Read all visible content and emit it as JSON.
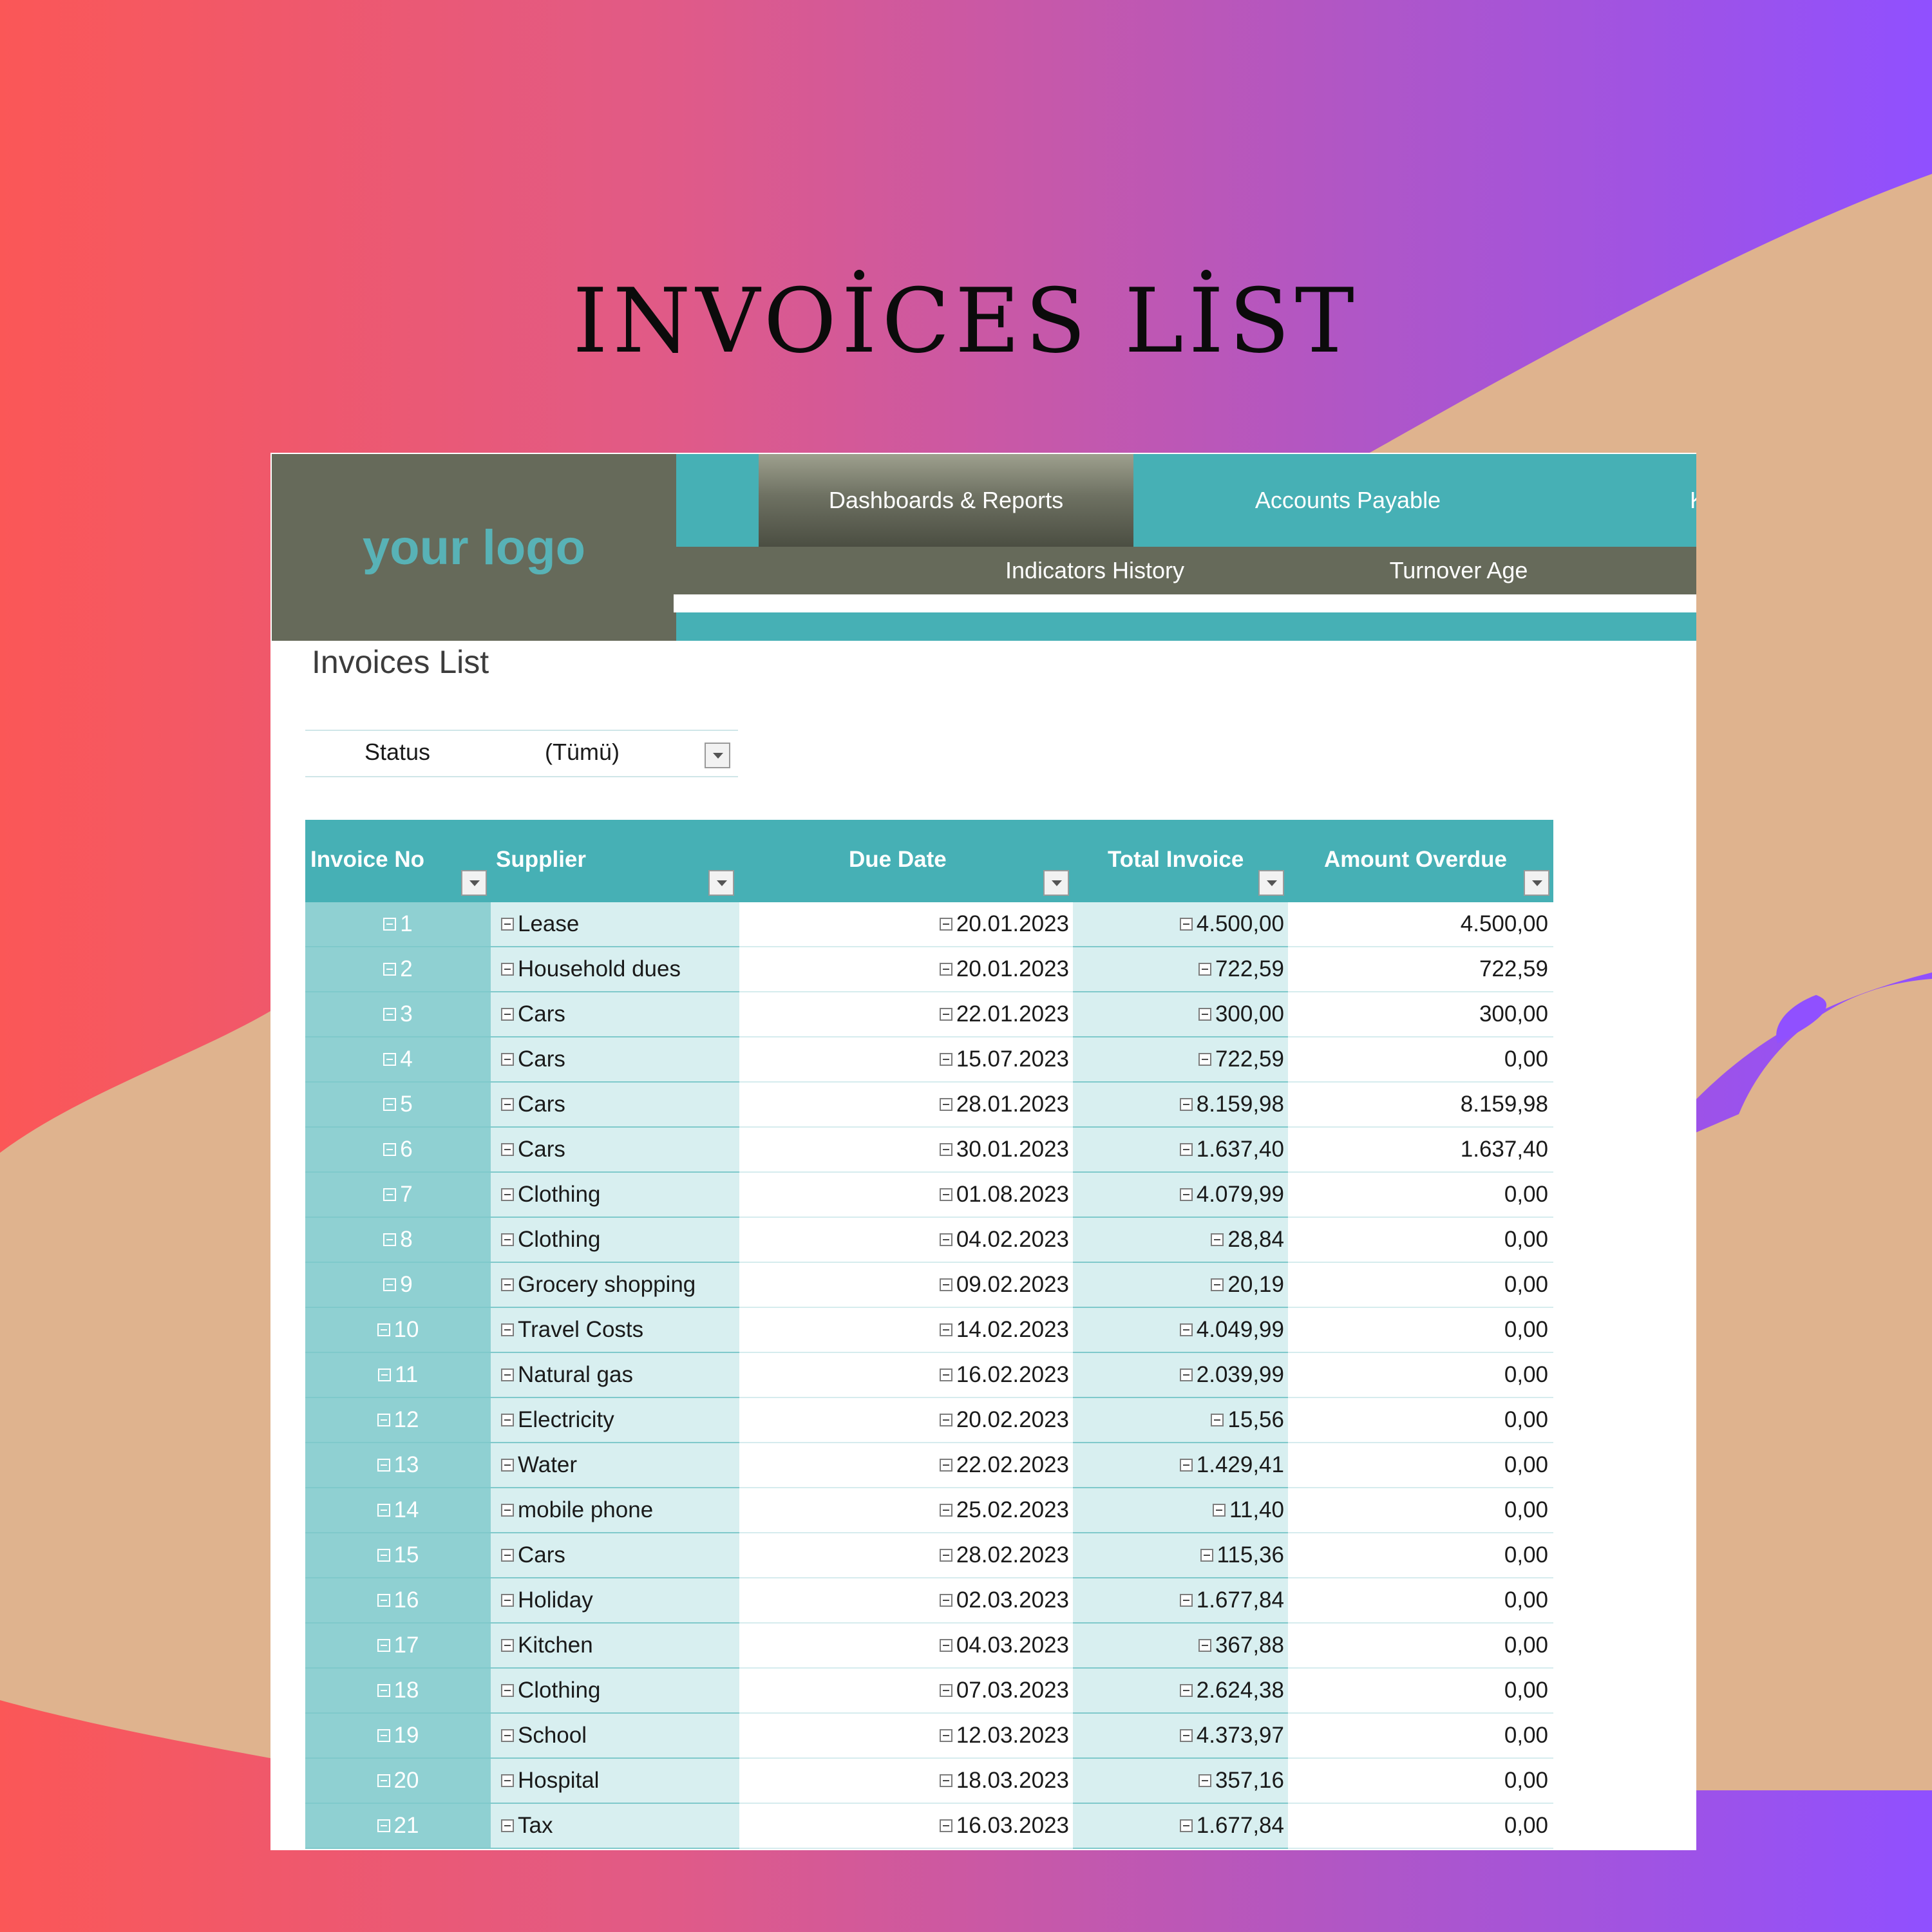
{
  "poster_title": "INVOİCES LİST",
  "logo": "your logo",
  "nav": {
    "tabs": [
      {
        "label": "Dashboards & Reports",
        "active": true
      },
      {
        "label": "Accounts Payable",
        "active": false
      },
      {
        "label": "K",
        "active": false
      }
    ],
    "subtabs": [
      "Indicators History",
      "Turnover Age"
    ]
  },
  "page_title": "Invoices List",
  "filter": {
    "label": "Status",
    "value": "(Tümü)"
  },
  "table": {
    "headers": [
      "Invoice No",
      "Supplier",
      "Due Date",
      "Total Invoice",
      "Amount Overdue"
    ],
    "rows": [
      {
        "no": "1",
        "supplier": "Lease",
        "due": "20.01.2023",
        "total": "4.500,00",
        "overdue": "4.500,00"
      },
      {
        "no": "2",
        "supplier": "Household dues",
        "due": "20.01.2023",
        "total": "722,59",
        "overdue": "722,59"
      },
      {
        "no": "3",
        "supplier": "Cars",
        "due": "22.01.2023",
        "total": "300,00",
        "overdue": "300,00"
      },
      {
        "no": "4",
        "supplier": "Cars",
        "due": "15.07.2023",
        "total": "722,59",
        "overdue": "0,00"
      },
      {
        "no": "5",
        "supplier": "Cars",
        "due": "28.01.2023",
        "total": "8.159,98",
        "overdue": "8.159,98"
      },
      {
        "no": "6",
        "supplier": "Cars",
        "due": "30.01.2023",
        "total": "1.637,40",
        "overdue": "1.637,40"
      },
      {
        "no": "7",
        "supplier": "Clothing",
        "due": "01.08.2023",
        "total": "4.079,99",
        "overdue": "0,00"
      },
      {
        "no": "8",
        "supplier": "Clothing",
        "due": "04.02.2023",
        "total": "28,84",
        "overdue": "0,00"
      },
      {
        "no": "9",
        "supplier": "Grocery shopping",
        "due": "09.02.2023",
        "total": "20,19",
        "overdue": "0,00"
      },
      {
        "no": "10",
        "supplier": "Travel Costs",
        "due": "14.02.2023",
        "total": "4.049,99",
        "overdue": "0,00"
      },
      {
        "no": "11",
        "supplier": "Natural gas",
        "due": "16.02.2023",
        "total": "2.039,99",
        "overdue": "0,00"
      },
      {
        "no": "12",
        "supplier": "Electricity",
        "due": "20.02.2023",
        "total": "15,56",
        "overdue": "0,00"
      },
      {
        "no": "13",
        "supplier": "Water",
        "due": "22.02.2023",
        "total": "1.429,41",
        "overdue": "0,00"
      },
      {
        "no": "14",
        "supplier": "mobile phone",
        "due": "25.02.2023",
        "total": "11,40",
        "overdue": "0,00"
      },
      {
        "no": "15",
        "supplier": "Cars",
        "due": "28.02.2023",
        "total": "115,36",
        "overdue": "0,00"
      },
      {
        "no": "16",
        "supplier": "Holiday",
        "due": "02.03.2023",
        "total": "1.677,84",
        "overdue": "0,00"
      },
      {
        "no": "17",
        "supplier": "Kitchen",
        "due": "04.03.2023",
        "total": "367,88",
        "overdue": "0,00"
      },
      {
        "no": "18",
        "supplier": "Clothing",
        "due": "07.03.2023",
        "total": "2.624,38",
        "overdue": "0,00"
      },
      {
        "no": "19",
        "supplier": "School",
        "due": "12.03.2023",
        "total": "4.373,97",
        "overdue": "0,00"
      },
      {
        "no": "20",
        "supplier": "Hospital",
        "due": "18.03.2023",
        "total": "357,16",
        "overdue": "0,00"
      },
      {
        "no": "21",
        "supplier": "Tax",
        "due": "16.03.2023",
        "total": "1.677,84",
        "overdue": "0,00"
      }
    ]
  },
  "colors": {
    "teal": "#46b0b5",
    "olive": "#666a5a",
    "light_teal": "#d8eff0",
    "row_teal": "#8fd0d2"
  },
  "icons": {
    "row_toggle": "minus-icon",
    "filter_dropdown": "chevron-down-icon"
  }
}
